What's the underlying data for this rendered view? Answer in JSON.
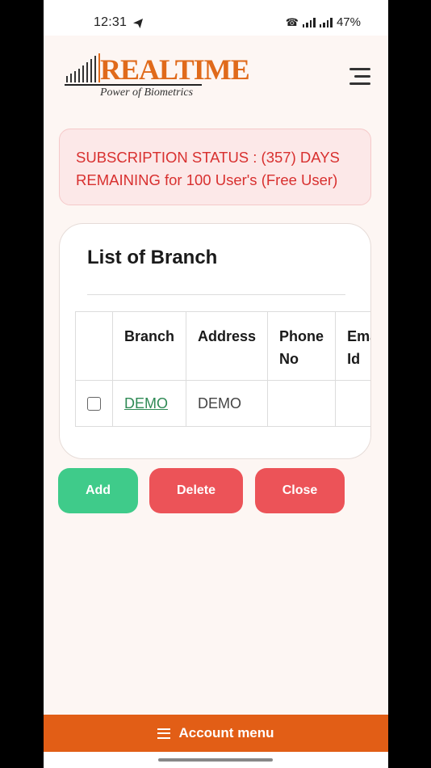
{
  "status_bar": {
    "time": "12:31",
    "battery": "47%"
  },
  "header": {
    "logo_word": "REALTIME",
    "logo_tagline": "Power of Biometrics"
  },
  "alert": {
    "text": "SUBSCRIPTION STATUS : (357) DAYS REMAINING for 100 User's (Free User)"
  },
  "card": {
    "title": "List of Branch",
    "columns": [
      "",
      "Branch",
      "Address",
      "Phone No",
      "Email Id"
    ],
    "rows": [
      {
        "branch": "DEMO",
        "address": "DEMO",
        "phone": "",
        "email": ""
      }
    ]
  },
  "buttons": {
    "add": "Add",
    "delete": "Delete",
    "close": "Close"
  },
  "bottom_bar": {
    "label": "Account menu"
  },
  "colors": {
    "brand_orange": "#e25e16",
    "add_green": "#3fcb8a",
    "danger_red": "#ec5358",
    "alert_text": "#d8302f"
  }
}
